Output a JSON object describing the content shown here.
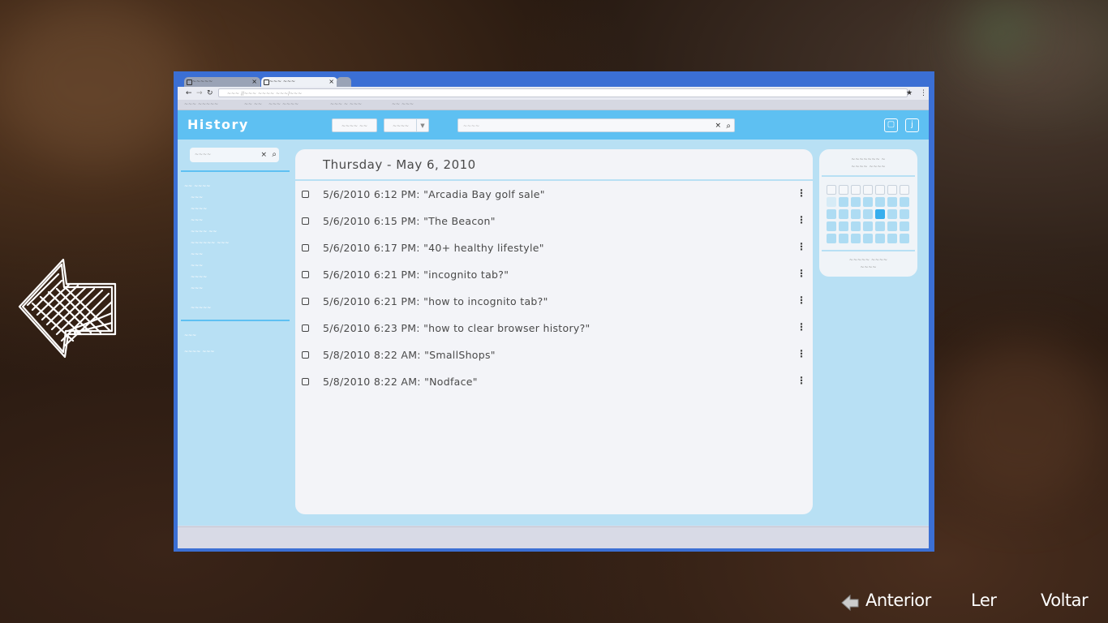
{
  "browser": {
    "tabs": [
      {
        "label": "~~~~~"
      },
      {
        "label": "~~~ ~~~"
      }
    ],
    "address": "~~~ //~~~ ~~~~ ~~~/~~~",
    "bookmarks": [
      "~~~ ~~~~~",
      "~~ ~~",
      "~~~ ~~~~",
      "~~~ ~ ~~~",
      "~~ ~~~"
    ]
  },
  "page": {
    "title": "History",
    "header_buttons": [
      "~~~~ ~~",
      "~~~~"
    ],
    "search_placeholder": "~~~~",
    "sidebar": {
      "search_placeholder": "~~~~",
      "items": [
        "~~ ~~~~",
        "~~~",
        "~~~~",
        "~~~",
        "~~~~ ~~",
        "~~~~~~ ~~~",
        "~~~",
        "~~~",
        "~~~~",
        "~~~",
        "~~~~~"
      ],
      "footer_items": [
        "~~~",
        "~~~~ ~~~"
      ]
    },
    "date_heading": "Thursday - May 6, 2010",
    "entries": [
      "5/6/2010 6:12 PM: \"Arcadia Bay golf sale\"",
      "5/6/2010 6:15 PM: \"The Beacon\"",
      "5/6/2010 6:17 PM: \"40+ healthy lifestyle\"",
      "5/6/2010 6:21 PM: \"incognito tab?\"",
      "5/6/2010 6:21 PM: \"how to incognito tab?\"",
      "5/6/2010 6:23 PM: \"how to clear browser history?\"",
      "5/8/2010 8:22 AM: \"SmallShops\"",
      "5/8/2010 8:22 AM: \"Nodface\""
    ],
    "calendar": {
      "head_line1": "~~~~~~~ ~",
      "head_line2": "~~~~ ~~~~",
      "foot_line1": "~~~~~ ~~~~",
      "foot_line2": "~~~~"
    }
  },
  "nav": {
    "previous": "Anterior",
    "read": "Ler",
    "back": "Voltar"
  },
  "colors": {
    "monitor_frame": "#3b6fd4",
    "header": "#5ec0f2",
    "page_bg": "#b8e0f4",
    "selected_day": "#37aeed"
  }
}
